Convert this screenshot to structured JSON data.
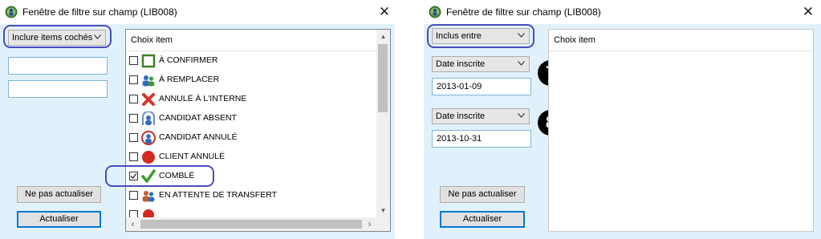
{
  "left_window": {
    "title": "Fenêtre de filtre sur champ (LIB008)",
    "close_glyph": "✕",
    "filter_combo": "Inclure items cochés",
    "list_header": "Choix item",
    "items": [
      {
        "label": "À CONFIRMER",
        "checked": false,
        "icon": "green-square-icon"
      },
      {
        "label": "À REMPLACER",
        "checked": false,
        "icon": "people-icon"
      },
      {
        "label": "ANNULÉ À L'INTERNE",
        "checked": false,
        "icon": "red-x-icon"
      },
      {
        "label": "CANDIDAT ABSENT",
        "checked": false,
        "icon": "person-frame-icon"
      },
      {
        "label": "CANDIDAT ANNULÉ",
        "checked": false,
        "icon": "person-cancel-icon"
      },
      {
        "label": "CLIENT ANNULÉ",
        "checked": false,
        "icon": "red-stop-icon"
      },
      {
        "label": "COMBLÉ",
        "checked": true,
        "icon": "green-check-icon"
      },
      {
        "label": "EN ATTENTE DE TRANSFERT",
        "checked": false,
        "icon": "people-transfer-icon"
      }
    ],
    "no_refresh_button": "Ne pas actualiser",
    "refresh_button": "Actualiser"
  },
  "right_window": {
    "title": "Fenêtre de filtre sur champ (LIB008)",
    "close_glyph": "✕",
    "filter_combo": "Inclus entre",
    "date_type_1": "Date inscrite",
    "date_value_1": "2013-01-09",
    "date_type_2": "Date inscrite",
    "date_value_2": "2013-10-31",
    "list_header": "Choix item",
    "no_refresh_button": "Ne pas actualiser",
    "refresh_button": "Actualiser",
    "step_badges": [
      "7",
      "8"
    ]
  },
  "colors": {
    "client_bg": "#e1f1fb",
    "highlight": "#4b4bbf",
    "field_border": "#7fb4dd"
  }
}
